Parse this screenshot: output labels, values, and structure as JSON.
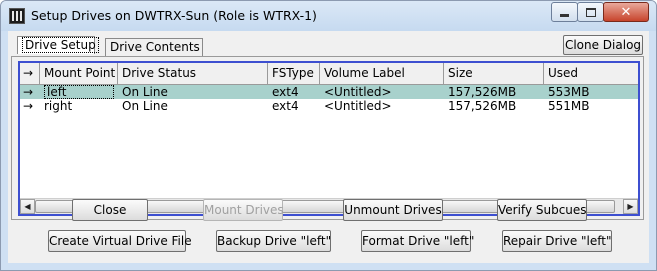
{
  "window": {
    "title": "Setup Drives on DWTRX-Sun (Role is WTRX-1)",
    "close_glyph": "✕"
  },
  "tabs": [
    {
      "label": "Drive Setup",
      "active": true
    },
    {
      "label": "Drive Contents",
      "active": false
    }
  ],
  "clone_dialog_label": "Clone Dialog",
  "table": {
    "columns": [
      "→",
      "Mount Point",
      "Drive Status",
      "FSType",
      "Volume Label",
      "Size",
      "Used"
    ],
    "rows": [
      {
        "arrow": "→",
        "mount": "left",
        "status": "On Line",
        "fstype": "ext4",
        "label": "<Untitled>",
        "size": "157,526MB",
        "used": "553MB",
        "selected": true
      },
      {
        "arrow": "→",
        "mount": "right",
        "status": "On Line",
        "fstype": "ext4",
        "label": "<Untitled>",
        "size": "157,526MB",
        "used": "551MB",
        "selected": false
      }
    ],
    "scroll_left": "◀",
    "scroll_right": "▶"
  },
  "buttons": {
    "close": "Close",
    "mount_drives": "Mount Drives",
    "unmount_drives": "Unmount Drives",
    "verify_subcues": "Verify Subcues",
    "create_virtual_drive": "Create Virtual Drive File",
    "backup_drive": "Backup Drive \"left\"",
    "format_drive": "Format Drive \"left\"",
    "repair_drive": "Repair Drive \"left\""
  },
  "colors": {
    "selection": "#a8d1cc",
    "grid_border": "#3d4fd0",
    "titlebar": "#cfe0f3",
    "close_button": "#c7442c"
  }
}
